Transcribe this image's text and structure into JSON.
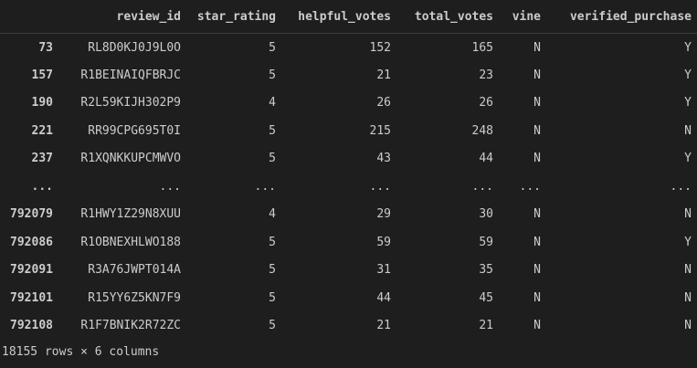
{
  "dataframe": {
    "columns": [
      "",
      "review_id",
      "star_rating",
      "helpful_votes",
      "total_votes",
      "vine",
      "verified_purchase"
    ],
    "rows": [
      [
        "73",
        "RL8D0KJ0J9L0O",
        "5",
        "152",
        "165",
        "N",
        "Y"
      ],
      [
        "157",
        "R1BEINAIQFBRJC",
        "5",
        "21",
        "23",
        "N",
        "Y"
      ],
      [
        "190",
        "R2L59KIJH302P9",
        "4",
        "26",
        "26",
        "N",
        "Y"
      ],
      [
        "221",
        "RR99CPG695T0I",
        "5",
        "215",
        "248",
        "N",
        "N"
      ],
      [
        "237",
        "R1XQNKKUPCMWVO",
        "5",
        "43",
        "44",
        "N",
        "Y"
      ],
      [
        "...",
        "...",
        "...",
        "...",
        "...",
        "...",
        "..."
      ],
      [
        "792079",
        "R1HWY1Z29N8XUU",
        "4",
        "29",
        "30",
        "N",
        "N"
      ],
      [
        "792086",
        "R1OBNEXHLWO188",
        "5",
        "59",
        "59",
        "N",
        "Y"
      ],
      [
        "792091",
        "R3A76JWPT014A",
        "5",
        "31",
        "35",
        "N",
        "N"
      ],
      [
        "792101",
        "R15YY6Z5KN7F9",
        "5",
        "44",
        "45",
        "N",
        "N"
      ],
      [
        "792108",
        "R1F7BNIK2R72ZC",
        "5",
        "21",
        "21",
        "N",
        "N"
      ]
    ],
    "shape_text": "18155 rows × 6 columns"
  }
}
